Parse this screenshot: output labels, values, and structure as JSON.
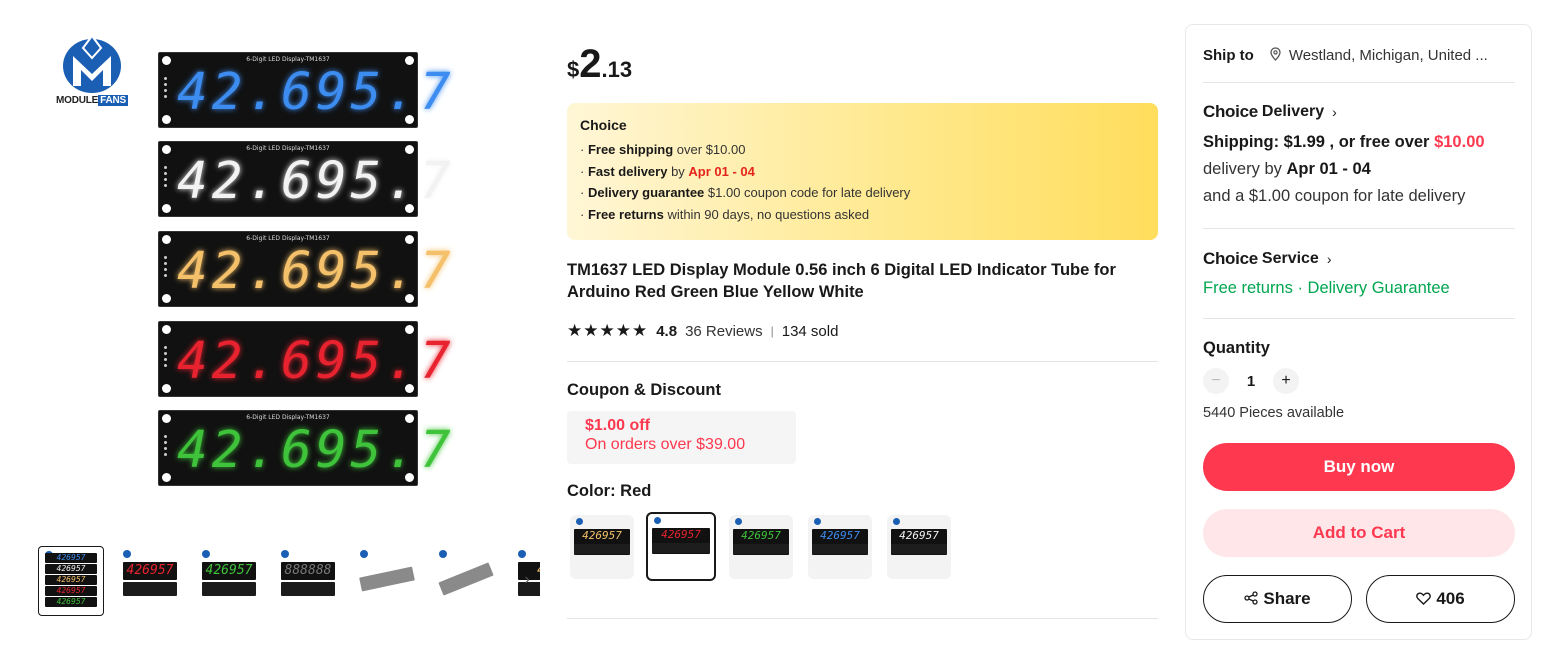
{
  "gallery": {
    "brand": {
      "name": "MODULE",
      "name_highlight": "FANS"
    },
    "main_modules": [
      {
        "label": "6-Digit LED Display-TM1637",
        "digits": "42.695.7",
        "color": "#3d8cf0"
      },
      {
        "label": "6-Digit LED Display-TM1637",
        "digits": "42.695.7",
        "color": "#f2f2f2"
      },
      {
        "label": "6-Digit LED Display-TM1637",
        "digits": "42.695.7",
        "color": "#f4c06a"
      },
      {
        "label": "",
        "digits": "42.695.7",
        "color": "#e8232f"
      },
      {
        "label": "6-Digit LED Display-TM1637",
        "digits": "42.695.7",
        "color": "#3fc33a"
      }
    ],
    "thumbnails": [
      {
        "name": "all-colors",
        "digits": "426957",
        "color": "#3d8cf0"
      },
      {
        "name": "red",
        "digits": "426957",
        "color": "#e8232f"
      },
      {
        "name": "green",
        "digits": "426957",
        "color": "#3fc33a"
      },
      {
        "name": "blank",
        "digits": "888888",
        "color": "#777777"
      },
      {
        "name": "side-view",
        "digits": "",
        "color": "#999999"
      },
      {
        "name": "angle-view",
        "digits": "",
        "color": "#999999"
      },
      {
        "name": "partial",
        "digits": "42",
        "color": "#f4c06a"
      }
    ],
    "next_icon": "›"
  },
  "price": {
    "currency": "$",
    "integer": "2",
    "decimal": ".13"
  },
  "choice": {
    "title": "Choice",
    "lines": [
      {
        "bold": "Free shipping",
        "rest": " over $10.00",
        "red": ""
      },
      {
        "bold": "Fast delivery",
        "rest": " by ",
        "red": "Apr 01 - 04"
      },
      {
        "bold": "Delivery guarantee",
        "rest": "  $1.00 coupon code for late delivery",
        "red": ""
      },
      {
        "bold": "Free returns",
        "rest": "  within 90 days, no questions asked",
        "red": ""
      }
    ]
  },
  "product": {
    "title": "TM1637 LED Display Module 0.56 inch 6 Digital LED Indicator Tube for Arduino Red Green Blue Yellow White",
    "stars": "★★★★★",
    "rating": "4.8",
    "reviews": "36 Reviews",
    "separator": "|",
    "sold": "134 sold"
  },
  "coupon": {
    "heading": "Coupon & Discount",
    "amount": "$1.00 off",
    "condition": "On orders over $39.00"
  },
  "color": {
    "heading": "Color: Red",
    "swatches": [
      {
        "name": "yellow",
        "digits": "426957",
        "color": "#f4c06a",
        "selected": false
      },
      {
        "name": "red",
        "digits": "426957",
        "color": "#e8232f",
        "selected": true
      },
      {
        "name": "green",
        "digits": "426957",
        "color": "#3fc33a",
        "selected": false
      },
      {
        "name": "blue",
        "digits": "426957",
        "color": "#3d8cf0",
        "selected": false
      },
      {
        "name": "white",
        "digits": "426957",
        "color": "#f2f2f2",
        "selected": false
      }
    ]
  },
  "panel": {
    "ship_label": "Ship to",
    "ship_icon": "location-pin-icon",
    "ship_address": "Westland, Michigan, United ...",
    "delivery_choice": "Choice",
    "delivery_word": "Delivery",
    "shipping_prefix": "Shipping: $1.99 , or free over ",
    "shipping_threshold": "$10.00",
    "delivery_by": "delivery by ",
    "delivery_dates": "Apr 01 - 04",
    "coupon_line": "and a $1.00 coupon for late delivery",
    "service_choice": "Choice",
    "service_word": "Service",
    "free_returns": "Free returns",
    "dot": " · ",
    "delivery_guarantee": "Delivery Guarantee",
    "quantity_label": "Quantity",
    "quantity_minus": "−",
    "quantity_value": "1",
    "quantity_plus": "+",
    "available": "5440 Pieces available",
    "buy_now": "Buy now",
    "add_to_cart": "Add to Cart",
    "share": "Share",
    "wishlist_count": "406"
  },
  "colors": {
    "accent": "#fd384f",
    "green": "#00a650",
    "choice_red": "#e4241a"
  }
}
